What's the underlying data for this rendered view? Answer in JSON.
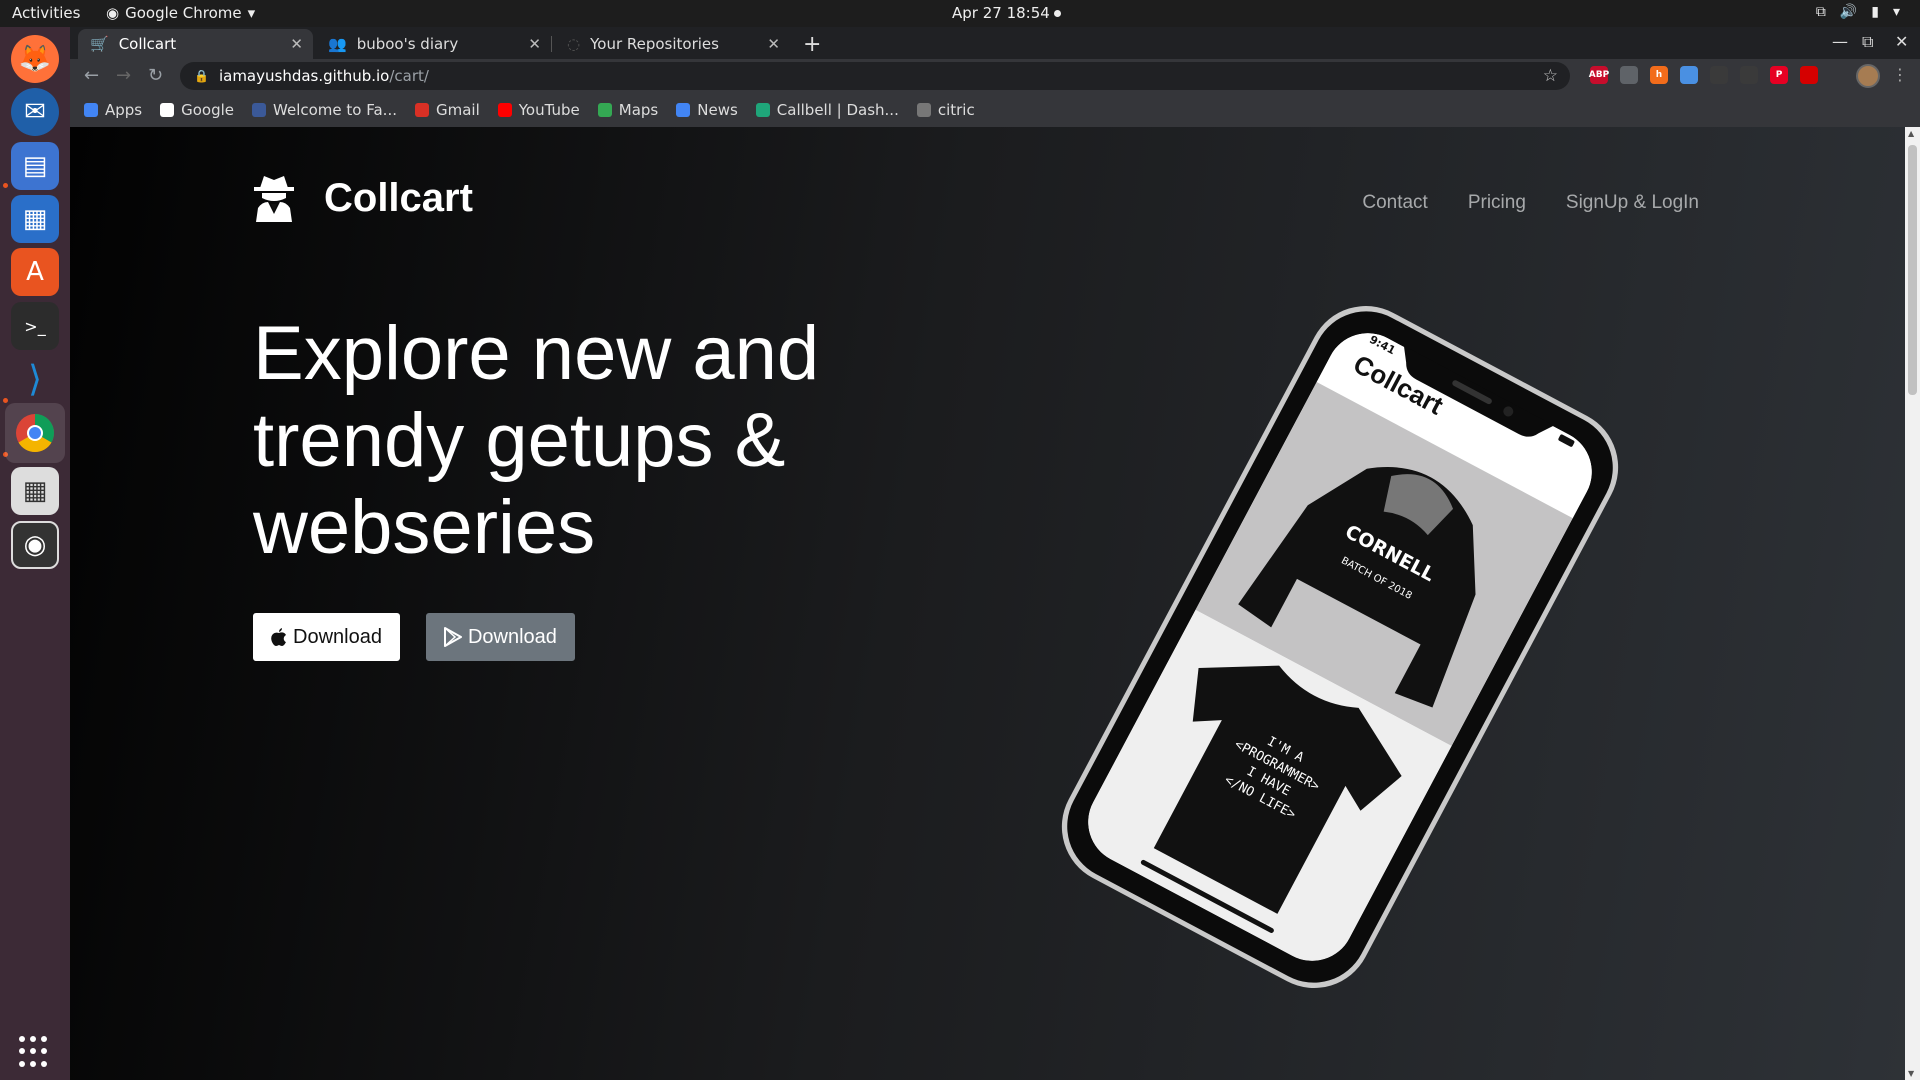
{
  "system": {
    "activities": "Activities",
    "app_menu": "Google Chrome",
    "clock": "Apr 27  18:54"
  },
  "browser": {
    "tabs": [
      {
        "label": "Collcart"
      },
      {
        "label": "buboo's diary"
      },
      {
        "label": "Your Repositories"
      }
    ],
    "url_host": "iamayushdas.github.io",
    "url_path": "/cart/",
    "bookmarks": [
      {
        "label": "Apps",
        "icon": "apps-grid-icon",
        "color": "#4285f4"
      },
      {
        "label": "Google",
        "icon": "google-icon",
        "color": "#ffffff"
      },
      {
        "label": "Welcome to Fa...",
        "icon": "facebook-icon",
        "color": "#3b5998"
      },
      {
        "label": "Gmail",
        "icon": "gmail-icon",
        "color": "#d93025"
      },
      {
        "label": "YouTube",
        "icon": "youtube-icon",
        "color": "#ff0000"
      },
      {
        "label": "Maps",
        "icon": "maps-icon",
        "color": "#34a853"
      },
      {
        "label": "News",
        "icon": "news-icon",
        "color": "#4285f4"
      },
      {
        "label": "Callbell | Dash...",
        "icon": "callbell-icon",
        "color": "#1fa67a"
      },
      {
        "label": "citric",
        "icon": "citric-icon",
        "color": "#777777"
      }
    ],
    "extensions": [
      {
        "name": "adblock-icon",
        "text": "ABP",
        "color": "#c70d2c"
      },
      {
        "name": "extension-circle-icon",
        "text": "",
        "color": "#5f6368"
      },
      {
        "name": "honey-icon",
        "text": "h",
        "color": "#f26c1b"
      },
      {
        "name": "globe-icon",
        "text": "",
        "color": "#4a90e2"
      },
      {
        "name": "react-icon",
        "text": "",
        "color": "#3a3a3a"
      },
      {
        "name": "cloud-icon",
        "text": "",
        "color": "#3a3a3a"
      },
      {
        "name": "pinterest-icon",
        "text": "P",
        "color": "#e60023"
      },
      {
        "name": "reader-icon",
        "text": "",
        "color": "#d50000"
      }
    ]
  },
  "page": {
    "brand": "Collcart",
    "nav": [
      "Contact",
      "Pricing",
      "SignUp & LogIn"
    ],
    "hero_lines": [
      "Explore new and",
      "trendy getups &",
      "webseries"
    ],
    "download_apple": "Download",
    "download_play": "Download",
    "phone": {
      "time": "9:41",
      "app_brand": "Collcart",
      "hoodie_line1": "CORNELL",
      "hoodie_line2": "BATCH OF 2018",
      "tshirt_text": [
        "I'M A",
        "<PROGRAMMER>",
        "I HAVE",
        "</NO LIFE>"
      ]
    }
  }
}
